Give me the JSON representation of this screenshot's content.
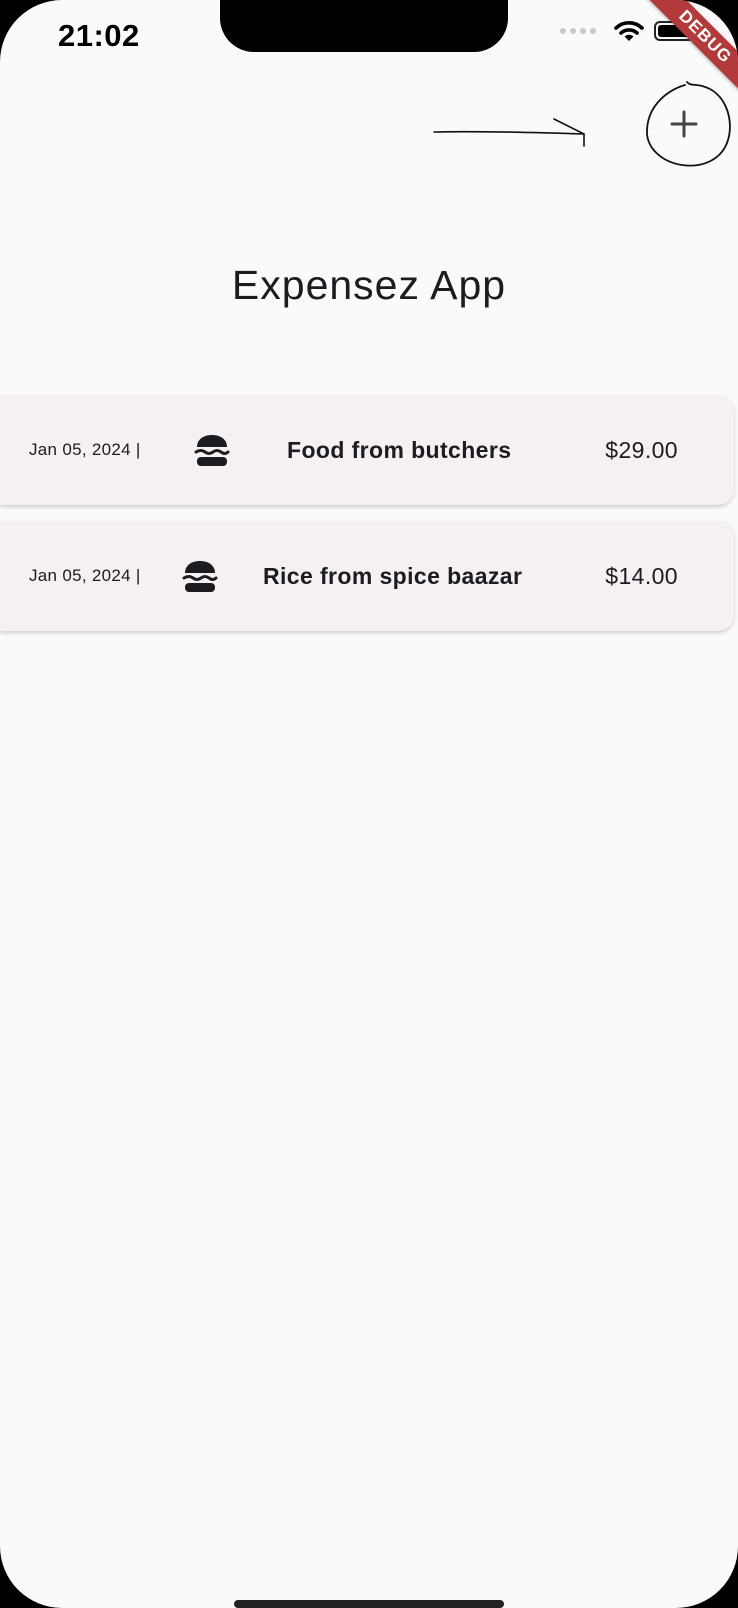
{
  "status_bar": {
    "time": "21:02",
    "debug_banner": "DEBUG"
  },
  "app_bar": {
    "add_button_icon": "plus-icon"
  },
  "page": {
    "title": "Expensez App"
  },
  "expenses": [
    {
      "date": "Jan 05, 2024 |",
      "category_icon": "burger-icon",
      "title": "Food from butchers",
      "amount": "$29.00"
    },
    {
      "date": "Jan 05, 2024 |",
      "category_icon": "burger-icon",
      "title": "Rice from spice baazar",
      "amount": "$14.00"
    }
  ],
  "colors": {
    "background": "#fcf9fc",
    "card": "#f4f0f4",
    "text": "#1d1b20",
    "debug_banner": "#b23a3a"
  }
}
